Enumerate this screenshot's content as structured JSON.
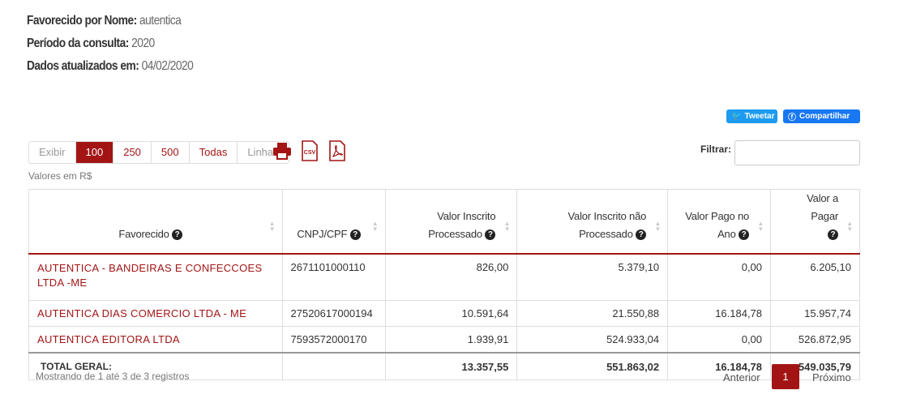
{
  "header": {
    "favorecido_label": "Favorecido por Nome:",
    "favorecido_value": "autentica",
    "periodo_label": "Período da consulta:",
    "periodo_value": "2020",
    "dados_label": "Dados atualizados em:",
    "dados_value": "04/02/2020"
  },
  "social": {
    "tweet": "Tweetar",
    "share": "Compartilhar"
  },
  "toolbar": {
    "exibir": "Exibir",
    "options": [
      "100",
      "250",
      "500",
      "Todas"
    ],
    "linhas": "Linhas",
    "exports": [
      "printer-icon",
      "csv-icon",
      "pdf-icon"
    ],
    "filter_label": "Filtrar:",
    "filter_value": ""
  },
  "valores_note": "Valores em R$",
  "table": {
    "headers": [
      "Favorecido",
      "CNPJ/CPF",
      "Valor Inscrito Processado",
      "Valor Inscrito não Processado",
      "Valor Pago no Ano",
      "Valor a Pagar"
    ],
    "headers_split": {
      "c2a": "Valor Inscrito",
      "c2b": "Processado",
      "c3a": "Valor Inscrito não",
      "c3b": "Processado",
      "c4a": "Valor Pago no",
      "c4b": "Ano",
      "c5a": "Valor a Pagar"
    },
    "rows": [
      [
        "AUTENTICA - BANDEIRAS E CONFECCOES LTDA -ME",
        "2671101000110",
        "826,00",
        "5.379,10",
        "0,00",
        "6.205,10"
      ],
      [
        "AUTENTICA DIAS COMERCIO LTDA - ME",
        "27520617000194",
        "10.591,64",
        "21.550,88",
        "16.184,78",
        "15.957,74"
      ],
      [
        "AUTENTICA EDITORA LTDA",
        "7593572000170",
        "1.939,91",
        "524.933,04",
        "0,00",
        "526.872,95"
      ]
    ],
    "total": [
      "TOTAL GERAL:",
      "",
      "13.357,55",
      "551.863,02",
      "16.184,78",
      "549.035,79"
    ]
  },
  "footer": {
    "showing": "Mostrando de 1 até 3 de 3 registros",
    "prev": "Anterior",
    "page": "1",
    "next": "Próximo"
  },
  "colors": {
    "accent": "#a31515",
    "twitter": "#1d9bf0",
    "facebook": "#1877f2"
  }
}
